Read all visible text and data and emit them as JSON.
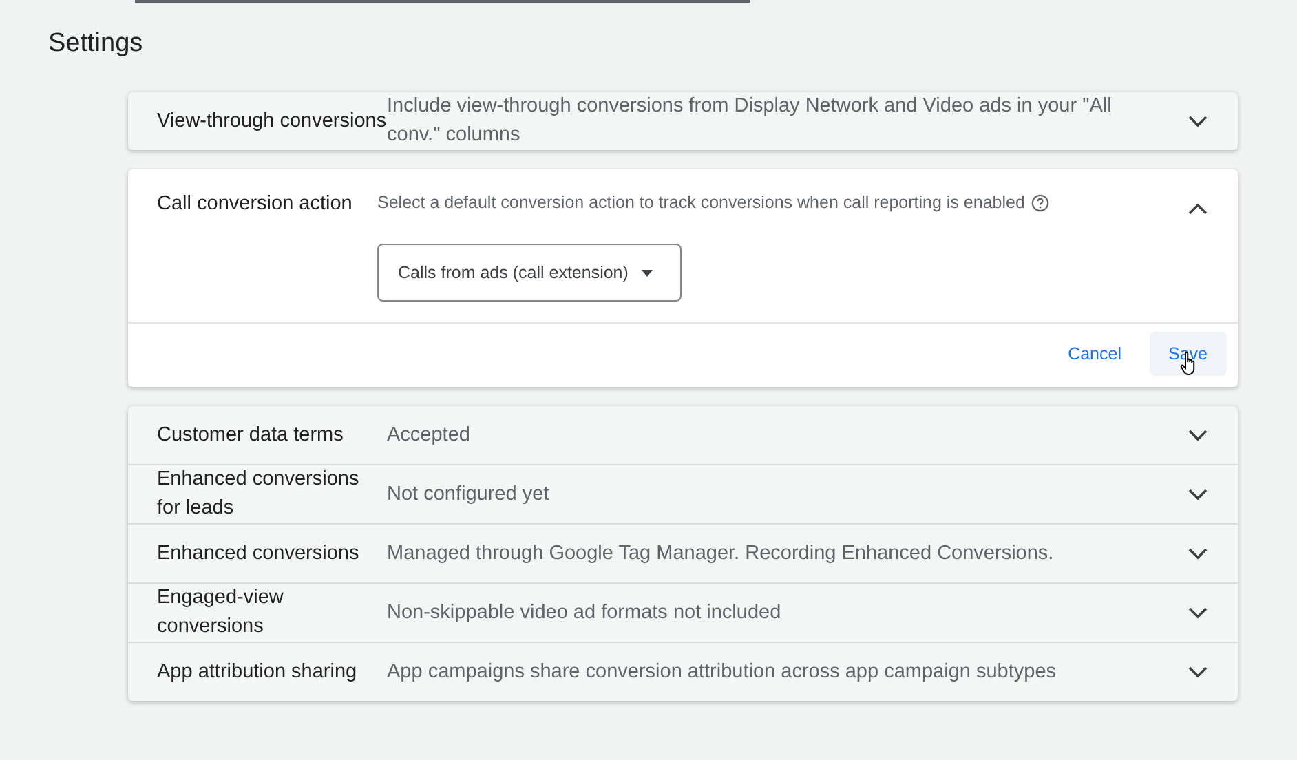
{
  "title": "Settings",
  "groups": [
    {
      "items": [
        {
          "label": "View-through conversions",
          "value": "Include view-through conversions from Display Network and Video ads in your \"All conv.\" columns",
          "expanded": false
        }
      ]
    },
    {
      "items": [
        {
          "label": "Call conversion action",
          "expanded": true,
          "description": "Select a default conversion action to track conversions when call reporting is enabled",
          "dropdown": "Calls from ads (call extension)",
          "buttons": [
            {
              "label": "Cancel",
              "hovered": false
            },
            {
              "label": "Save",
              "hovered": true
            }
          ]
        }
      ]
    },
    {
      "items": [
        {
          "label": "Customer data terms",
          "value": "Accepted",
          "expanded": false
        },
        {
          "label": "Enhanced conversions for leads",
          "value": "Not configured yet",
          "expanded": false
        },
        {
          "label": "Enhanced conversions",
          "value": "Managed through Google Tag Manager. Recording Enhanced Conversions.",
          "expanded": false
        },
        {
          "label": "Engaged-view conversions",
          "value": "Non-skippable video ad formats not included",
          "expanded": false
        },
        {
          "label": "App attribution sharing",
          "value": "App campaigns share conversion attribution across app campaign subtypes",
          "expanded": false
        }
      ]
    }
  ]
}
